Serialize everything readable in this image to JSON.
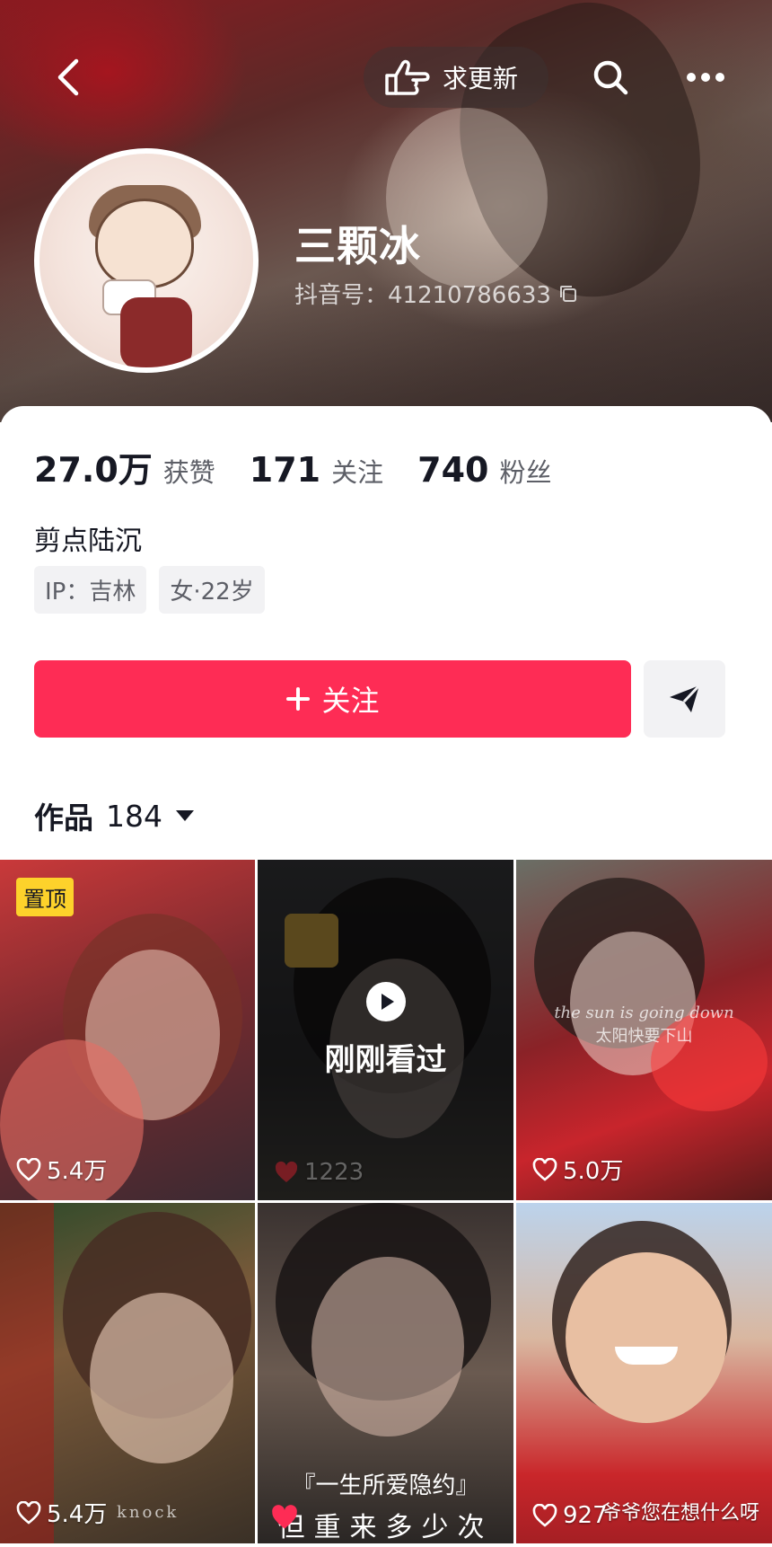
{
  "header": {
    "update_label": "求更新",
    "username": "三颗冰",
    "douyin_id": "抖音号：41210786633"
  },
  "stats": [
    {
      "value": "27.0万",
      "label": "获赞"
    },
    {
      "value": "171",
      "label": "关注"
    },
    {
      "value": "740",
      "label": "粉丝"
    }
  ],
  "bio": "剪点陆沉",
  "tags": [
    "IP：吉林",
    "女·22岁"
  ],
  "actions": {
    "follow_label": "关注"
  },
  "works": {
    "label": "作品",
    "count": "184"
  },
  "grid": [
    {
      "likes": "5.4万",
      "badge": "置顶"
    },
    {
      "likes": "1223",
      "overlay": "刚刚看过"
    },
    {
      "likes": "5.0万",
      "caption_top": "the sun is going down",
      "caption_bottom": "太阳快要下山"
    },
    {
      "likes": "5.4万",
      "caption": "knock"
    },
    {
      "likes": "",
      "subtitle1": "『一生所爱隐约』",
      "subtitle2": "但重来多少次"
    },
    {
      "likes": "927",
      "caption": "爷爷您在想什么呀"
    }
  ]
}
